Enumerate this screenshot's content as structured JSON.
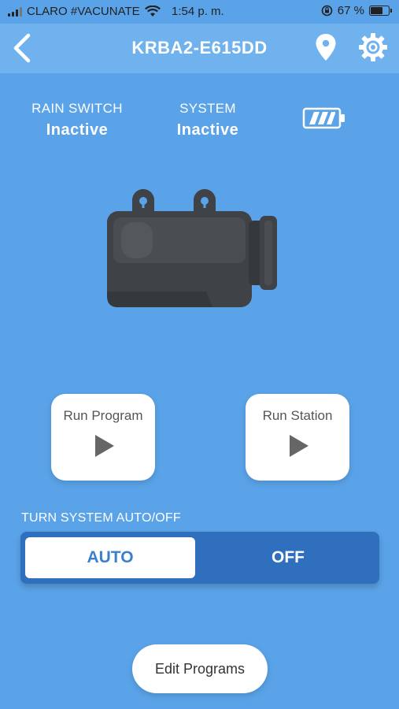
{
  "status_bar": {
    "carrier": "CLARO #VACUNATE",
    "time": "1:54 p. m.",
    "battery_percent": "67 %",
    "battery_level": 0.67
  },
  "header": {
    "title": "KRBA2-E615DD",
    "back_icon": "chevron-left-icon",
    "location_icon": "map-pin-icon",
    "settings_icon": "gear-icon"
  },
  "status": {
    "rain_switch_label": "RAIN SWITCH",
    "rain_switch_value": "Inactive",
    "system_label": "SYSTEM",
    "system_value": "Inactive",
    "battery_icon": "battery-icon"
  },
  "actions": {
    "run_program_label": "Run Program",
    "run_station_label": "Run Station",
    "play_icon": "play-icon"
  },
  "toggle": {
    "label": "TURN SYSTEM AUTO/OFF",
    "auto_label": "AUTO",
    "off_label": "OFF",
    "selected": "AUTO"
  },
  "footer": {
    "edit_programs_label": "Edit Programs"
  },
  "colors": {
    "background": "#5aa3e8",
    "header": "#6fb2ee",
    "toggle_bg": "#2f6fbd",
    "accent_text": "#3b7fd0",
    "device": "#3f4246"
  }
}
